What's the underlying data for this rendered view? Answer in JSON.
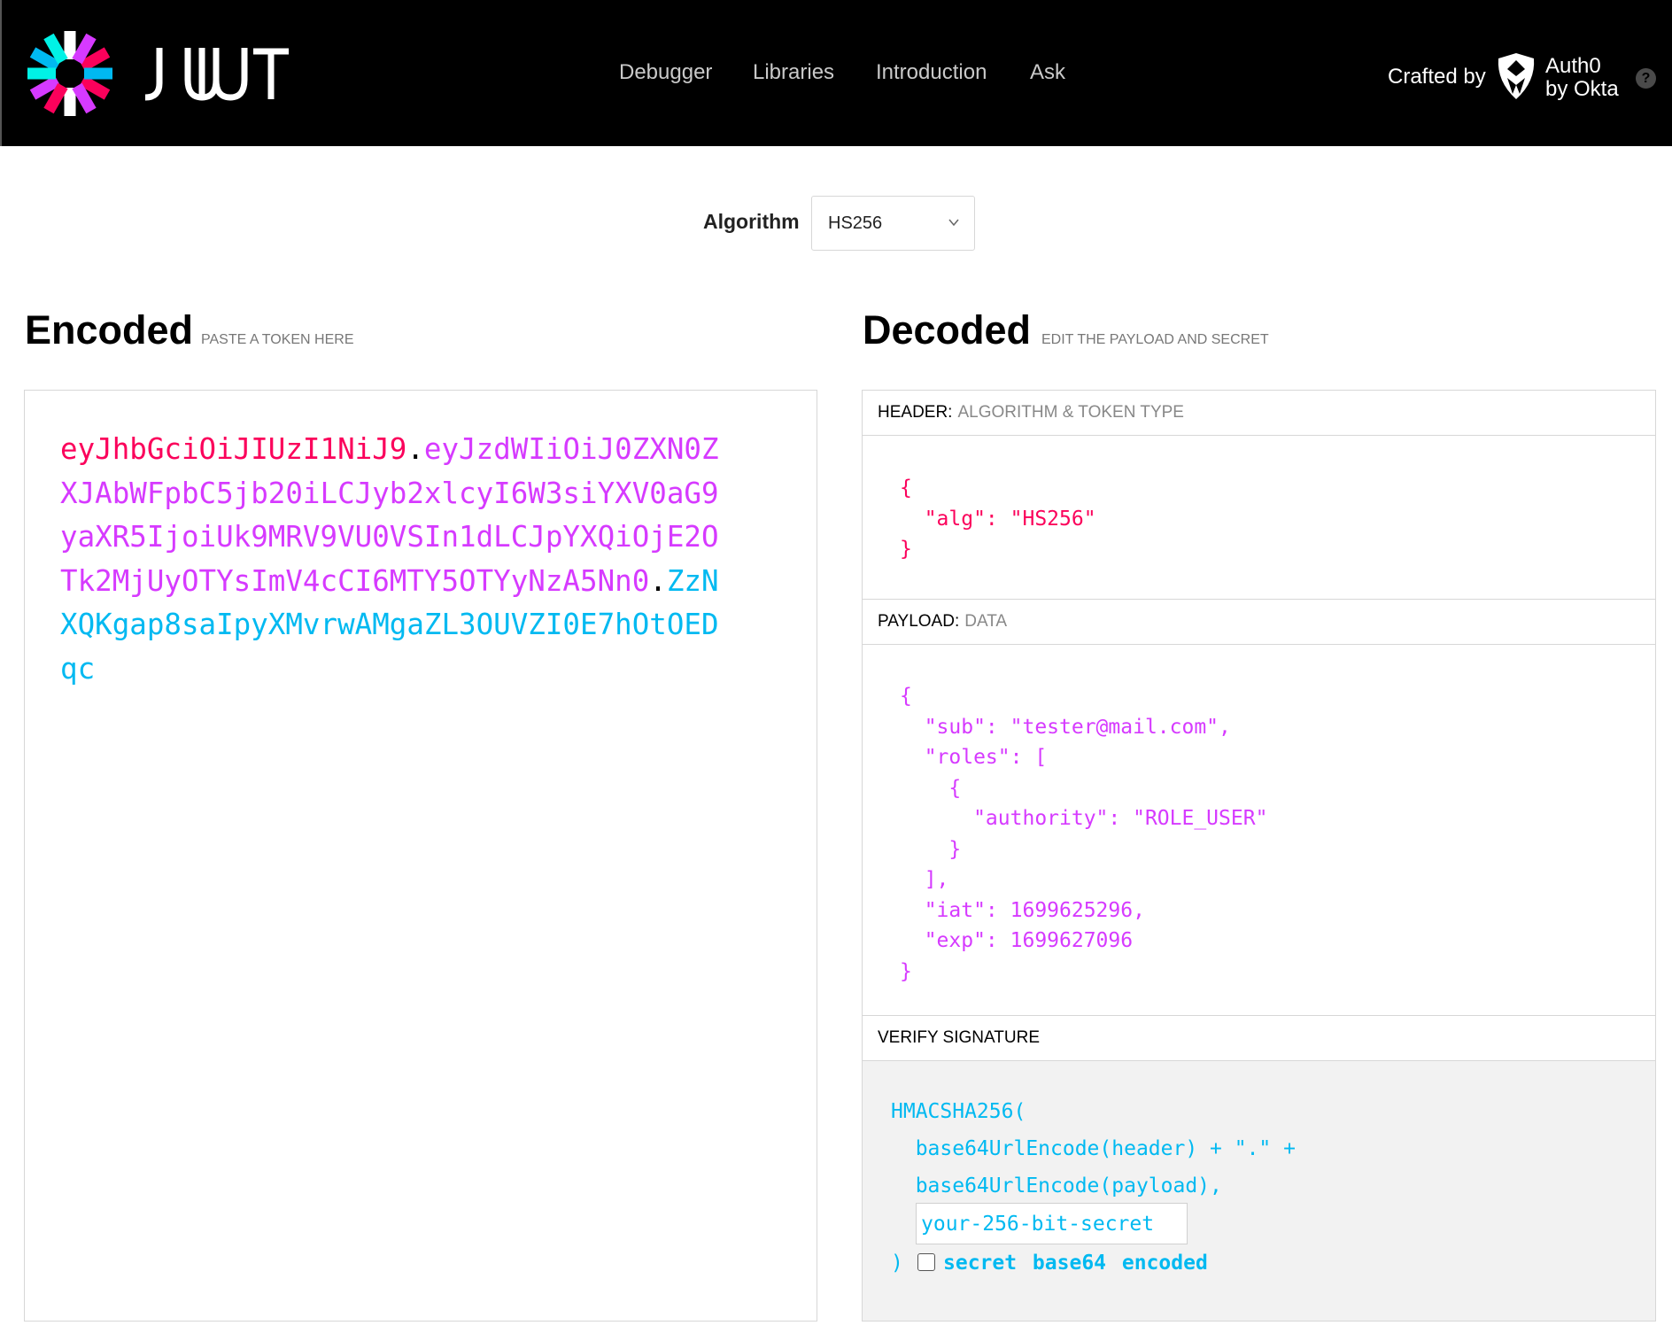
{
  "nav": {
    "logo_text": "JWT",
    "links": [
      "Debugger",
      "Libraries",
      "Introduction",
      "Ask"
    ],
    "crafted_by": "Crafted by",
    "brand_line1": "Auth0",
    "brand_line2": "by Okta",
    "help": "?"
  },
  "algorithm": {
    "label": "Algorithm",
    "selected": "HS256"
  },
  "encoded": {
    "title": "Encoded",
    "subtitle": "PASTE A TOKEN HERE",
    "header_part": "eyJhbGciOiJIUzI1NiJ9",
    "payload_part": "eyJzdWIiOiJ0ZXN0ZXJAbWFpbC5jb20iLCJyb2xlcyI6W3siYXV0aG9yaXR5IjoiUk9MRV9VU0VSIn1dLCJpYXQiOjE2OTk2MjUyOTYsImV4cCI6MTY5OTYyNzA5Nn0",
    "signature_part": "ZzNXQKgap8saIpyXMvrwAMgaZL3OUVZI0E7hOtOEDqc",
    "dot": "."
  },
  "decoded": {
    "title": "Decoded",
    "subtitle": "EDIT THE PAYLOAD AND SECRET",
    "header_section": {
      "key": "HEADER:",
      "desc": "ALGORITHM & TOKEN TYPE"
    },
    "header_json": "{\n  \"alg\": \"HS256\"\n}",
    "payload_section": {
      "key": "PAYLOAD:",
      "desc": "DATA"
    },
    "payload_json": "{\n  \"sub\": \"tester@mail.com\",\n  \"roles\": [\n    {\n      \"authority\": \"ROLE_USER\"\n    }\n  ],\n  \"iat\": 1699625296,\n  \"exp\": 1699627096\n}",
    "verify_section": {
      "title": "VERIFY SIGNATURE"
    },
    "verify_code": "HMACSHA256(\n  base64UrlEncode(header) + \".\" +\n  base64UrlEncode(payload),",
    "secret_placeholder": "your-256-bit-secret",
    "close_paren": ")",
    "secret_checkbox_label": "secret base64 encoded"
  },
  "colors": {
    "header": "#fb015b",
    "payload": "#d63aff",
    "signature": "#00b9f1",
    "topbar": "#000000"
  }
}
